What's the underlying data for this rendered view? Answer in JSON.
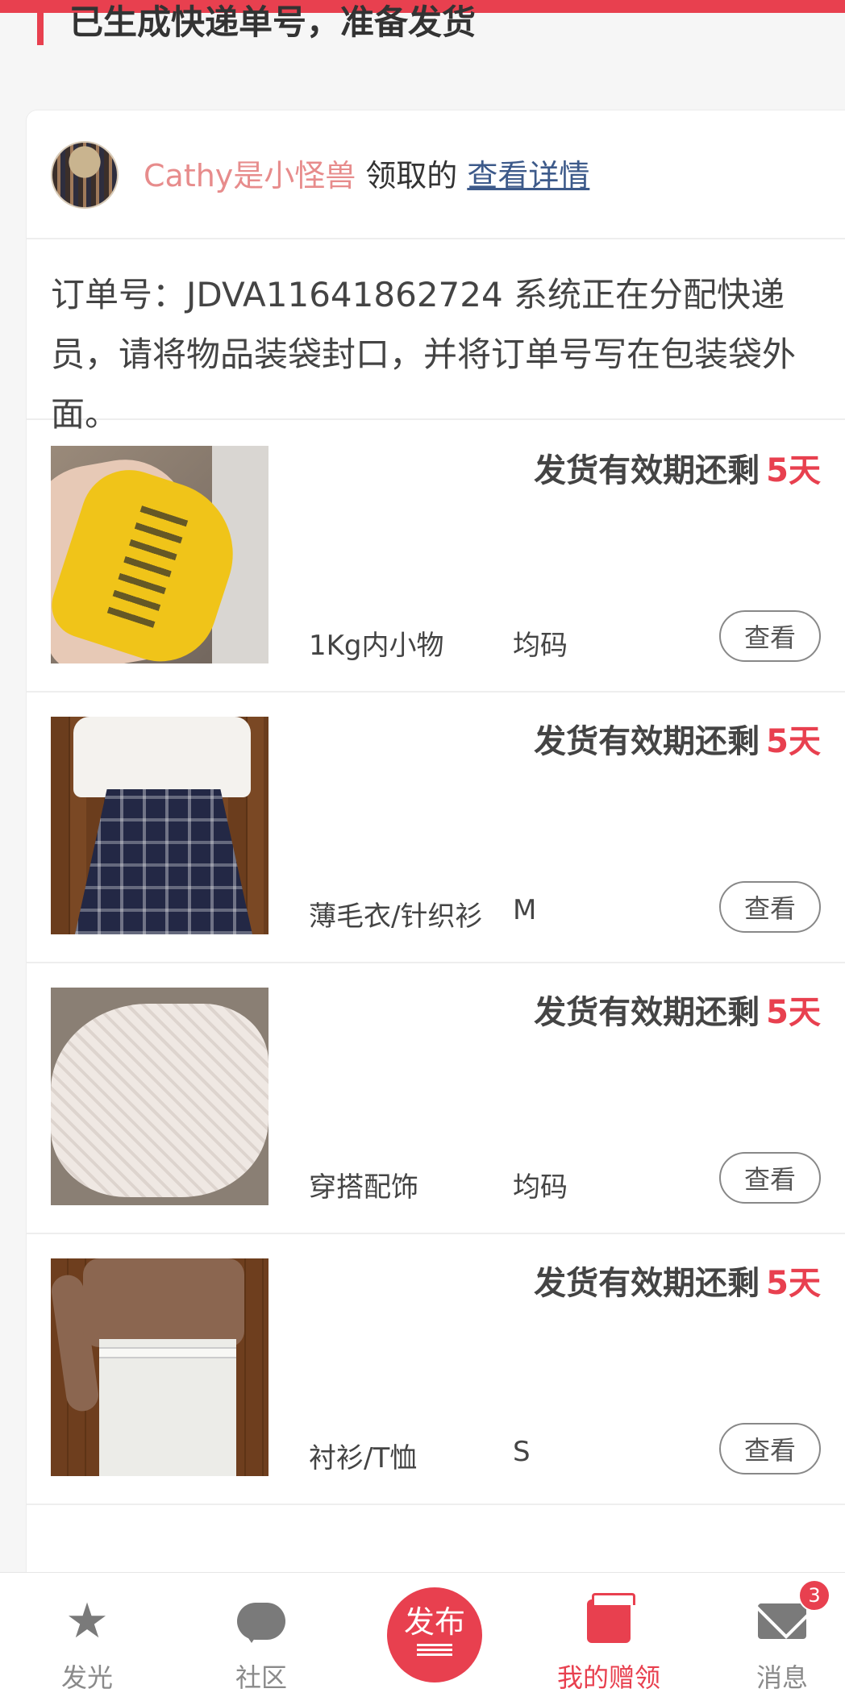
{
  "header": {
    "title": "已生成快递单号，准备发货"
  },
  "receiver": {
    "nickname": "Cathy是小怪兽",
    "suffix": "领取的",
    "detail_link": "查看详情"
  },
  "order": {
    "text": "订单号：JDVA11641862724 系统正在分配快递员，请将物品装袋封口，并将订单号写在包装袋外面。"
  },
  "items": [
    {
      "deadline_label": "发货有效期还剩",
      "days": "5天",
      "category": "1Kg内小物",
      "size": "均码",
      "button": "查看"
    },
    {
      "deadline_label": "发货有效期还剩",
      "days": "5天",
      "category": "薄毛衣/针织衫",
      "size": "M",
      "button": "查看"
    },
    {
      "deadline_label": "发货有效期还剩",
      "days": "5天",
      "category": "穿搭配饰",
      "size": "均码",
      "button": "查看"
    },
    {
      "deadline_label": "发货有效期还剩",
      "days": "5天",
      "category": "衬衫/T恤",
      "size": "S",
      "button": "查看"
    }
  ],
  "tabbar": {
    "tabs": [
      {
        "label": "发光",
        "icon": "star-icon"
      },
      {
        "label": "社区",
        "icon": "chat-bubble-icon"
      },
      {
        "label": "发布",
        "icon": "publish-icon"
      },
      {
        "label": "我的赠领",
        "icon": "gift-box-icon",
        "active": true
      },
      {
        "label": "消息",
        "icon": "envelope-icon",
        "badge": "3"
      }
    ]
  },
  "colors": {
    "accent": "#e8404f",
    "nickname": "#e78c8c",
    "link": "#3d5a8a"
  }
}
